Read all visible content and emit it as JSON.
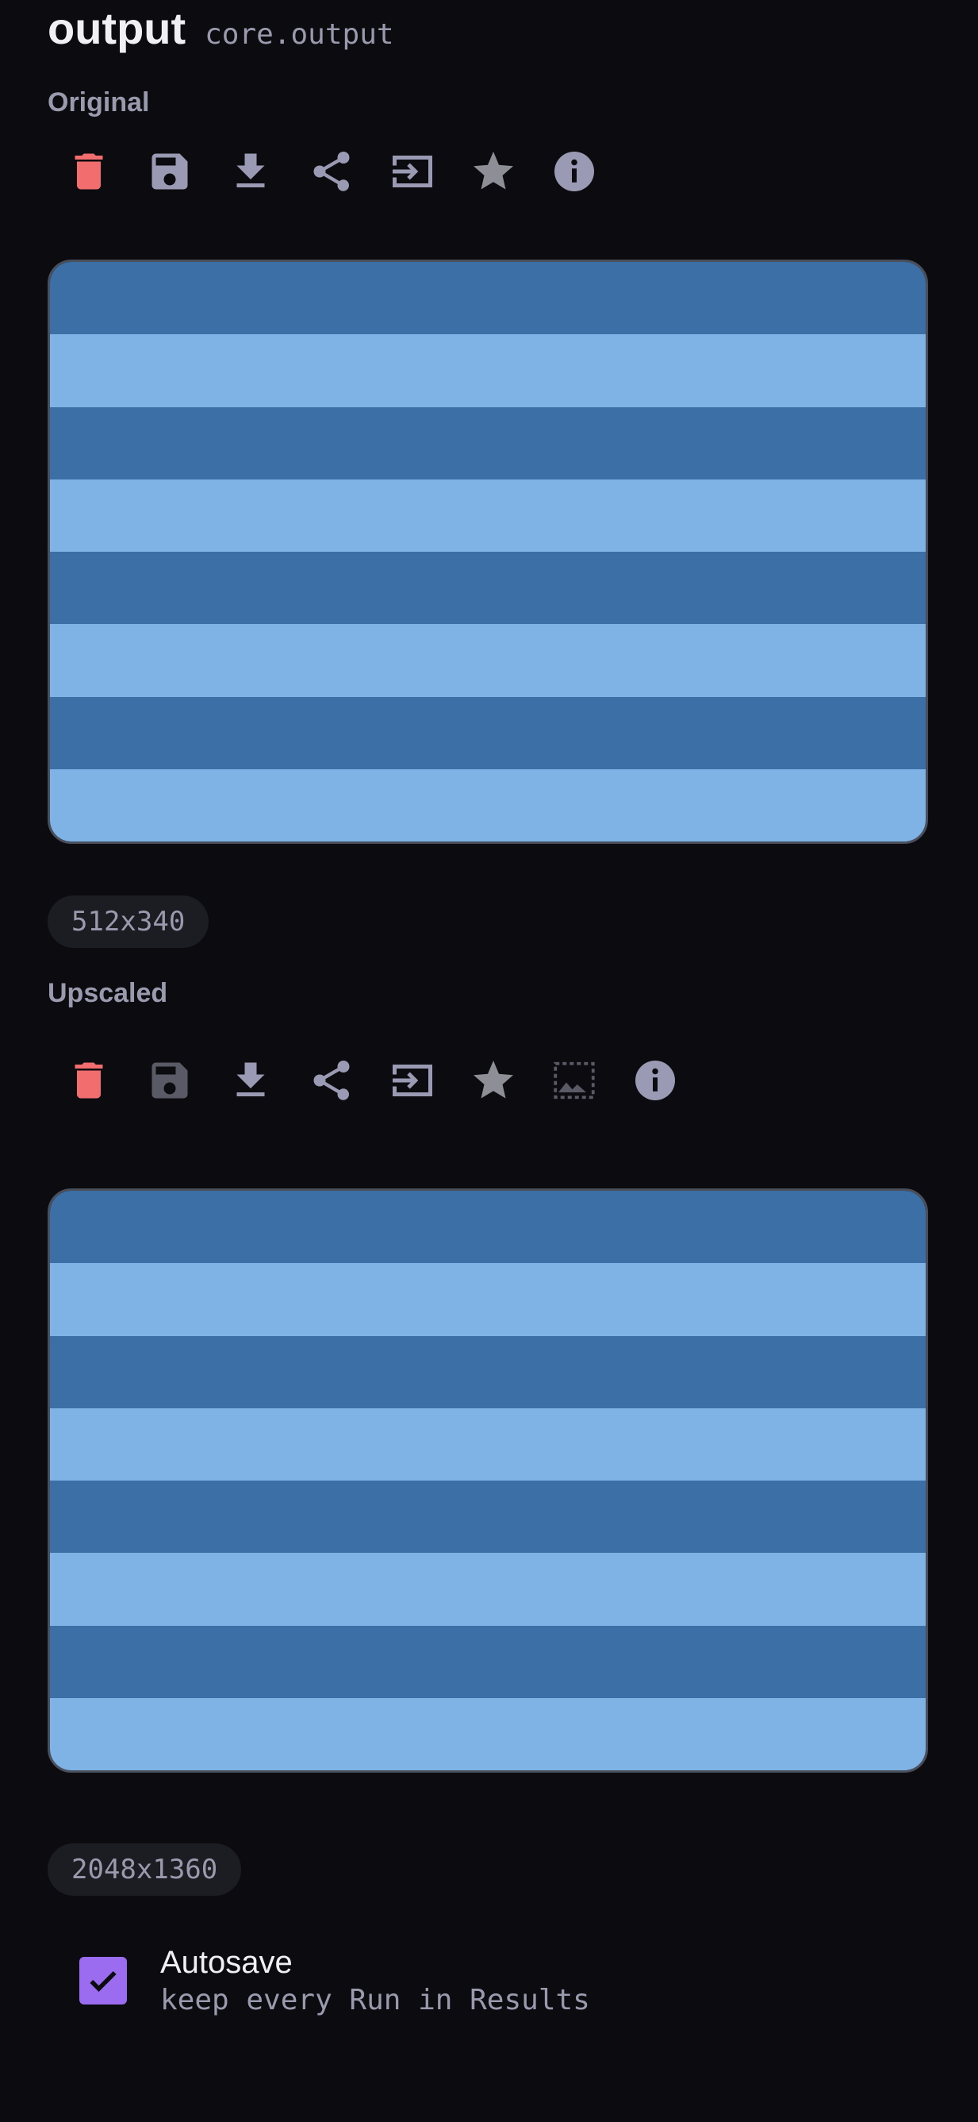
{
  "header": {
    "title": "output",
    "node_id": "core.output"
  },
  "original": {
    "label": "Original",
    "tools": [
      "trash-icon",
      "save-icon",
      "download-icon",
      "share-icon",
      "send-to-icon",
      "star-icon",
      "info-icon"
    ],
    "dimensions": "512x340"
  },
  "upscaled": {
    "label": "Upscaled",
    "tools": [
      "trash-icon",
      "save-icon",
      "download-icon",
      "share-icon",
      "send-to-icon",
      "star-icon",
      "crop-icon",
      "info-icon"
    ],
    "dimensions": "2048x1360"
  },
  "autosave": {
    "label": "Autosave",
    "hint": "keep every Run in Results",
    "checked": true
  },
  "colors": {
    "background": "#0c0c10",
    "danger": "#f26d6d",
    "icon": "#9a9ab4",
    "icon_dim": "#5a5a66",
    "accent": "#9b6cf0",
    "stripe_dark": "#3b6fa6",
    "stripe_light": "#7fb2e5"
  }
}
